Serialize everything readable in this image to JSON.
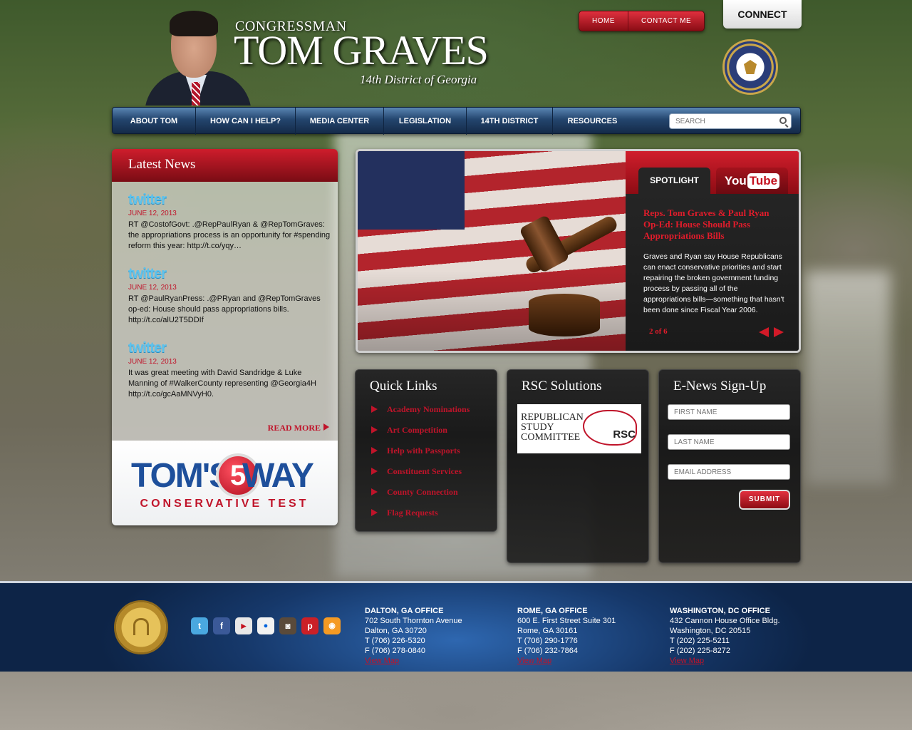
{
  "header": {
    "title_prefix": "CONGRESSMAN",
    "title_name": "TOM GRAVES",
    "subtitle": "14th District of Georgia",
    "top_links": [
      "HOME",
      "CONTACT ME"
    ],
    "connect_label": "CONNECT",
    "seal_icon": "us-congress-seal-icon"
  },
  "nav": {
    "items": [
      "ABOUT TOM",
      "HOW CAN I HELP?",
      "MEDIA CENTER",
      "LEGISLATION",
      "14TH DISTRICT",
      "RESOURCES"
    ],
    "search_placeholder": "SEARCH"
  },
  "latest_news": {
    "title": "Latest News",
    "tweets": [
      {
        "date": "JUNE 12, 2013",
        "text": "RT @CostofGovt: .@RepPaulRyan & @RepTomGraves: the appropriations process is an opportunity for #spending reform this year: http://t.co/yqy…"
      },
      {
        "date": "JUNE 12, 2013",
        "text": "RT @PaulRyanPress: .@PRyan and @RepTomGraves op-ed: House should pass appropriations bills. http://t.co/alU2T5DDIf"
      },
      {
        "date": "JUNE 12, 2013",
        "text": "It was great meeting with David Sandridge & Luke Manning of #WalkerCounty representing @Georgia4H http://t.co/gcAaMNVyH0."
      }
    ],
    "twitter_logo": "twitter",
    "read_more": "READ MORE",
    "promo": {
      "left": "TOM'S",
      "number": "5",
      "right": "WAY",
      "bottom": "CONSERVATIVE TEST"
    }
  },
  "feature": {
    "tab_spotlight": "SPOTLIGHT",
    "tab_youtube_you": "You",
    "tab_youtube_tube": "Tube",
    "headline": "Reps. Tom Graves & Paul Ryan Op-Ed: House Should Pass Appropriations Bills",
    "body": "Graves and Ryan say House Republicans can enact conservative priorities and start repairing the broken government funding process by passing all of the appropriations bills—something that hasn't been done since Fiscal Year 2006.",
    "counter": "2 of 6"
  },
  "quick_links": {
    "title": "Quick Links",
    "items": [
      "Academy Nominations",
      "Art Competition",
      "Help with Passports",
      "Constituent Services",
      "County Connection",
      "Flag Requests"
    ]
  },
  "rsc": {
    "title": "RSC Solutions",
    "logo_line1": "REPUBLICAN",
    "logo_line2": "STUDY",
    "logo_line3": "COMMITTEE",
    "logo_abbr": "RSC"
  },
  "enews": {
    "title": "E-News Sign-Up",
    "first_name_placeholder": "FIRST NAME",
    "last_name_placeholder": "LAST NAME",
    "email_placeholder": "EMAIL ADDRESS",
    "submit_label": "SUBMIT"
  },
  "footer": {
    "social_icons": [
      "twitter-icon",
      "facebook-icon",
      "youtube-icon",
      "flickr-icon",
      "instagram-icon",
      "pinterest-icon",
      "rss-icon"
    ],
    "offices": [
      {
        "heading": "DALTON, GA OFFICE",
        "line1": "702 South Thornton Avenue",
        "line2": "Dalton, GA 30720",
        "phone": "T (706) 226-5320",
        "fax": "F (706) 278-0840",
        "map": "View Map"
      },
      {
        "heading": "ROME, GA OFFICE",
        "line1": "600 E. First Street Suite 301",
        "line2": "Rome, GA 30161",
        "phone": "T (706) 290-1776",
        "fax": "F (706) 232-7864",
        "map": "View Map"
      },
      {
        "heading": "WASHINGTON, DC OFFICE",
        "line1": "432 Cannon House Office Bldg.",
        "line2": "Washington, DC 20515",
        "phone": "T (202) 225-5211",
        "fax": "F (202) 225-8272",
        "map": "View Map"
      }
    ]
  },
  "colors": {
    "accent_red": "#c0142a",
    "nav_blue": "#24466f",
    "footer_blue": "#16386a"
  }
}
